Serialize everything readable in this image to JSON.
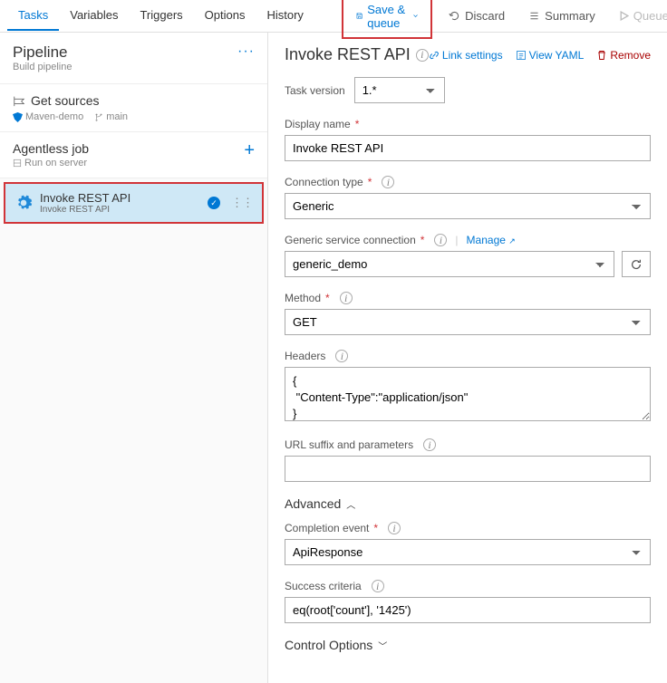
{
  "tabs": [
    "Tasks",
    "Variables",
    "Triggers",
    "Options",
    "History"
  ],
  "active_tab": 0,
  "toolbar": {
    "save": "Save & queue",
    "discard": "Discard",
    "summary": "Summary",
    "queue": "Queue",
    "more": "···"
  },
  "left": {
    "pipeline": {
      "title": "Pipeline",
      "sub": "Build pipeline"
    },
    "sources": {
      "title": "Get sources",
      "repo": "Maven-demo",
      "branch": "main"
    },
    "job": {
      "title": "Agentless job",
      "sub": "Run on server"
    },
    "task": {
      "title": "Invoke REST API",
      "sub": "Invoke REST API"
    }
  },
  "right": {
    "title": "Invoke REST API",
    "links": {
      "link": "Link settings",
      "yaml": "View YAML",
      "remove": "Remove"
    },
    "task_version": {
      "label": "Task version",
      "value": "1.*"
    },
    "display_name": {
      "label": "Display name",
      "value": "Invoke REST API"
    },
    "conn_type": {
      "label": "Connection type",
      "value": "Generic"
    },
    "service_conn": {
      "label": "Generic service connection",
      "value": "generic_demo",
      "manage": "Manage"
    },
    "method": {
      "label": "Method",
      "value": "GET"
    },
    "headers": {
      "label": "Headers",
      "value": "{\n \"Content-Type\":\"application/json\"\n}"
    },
    "url_suffix": {
      "label": "URL suffix and parameters",
      "value": ""
    },
    "advanced": "Advanced",
    "completion": {
      "label": "Completion event",
      "value": "ApiResponse"
    },
    "criteria": {
      "label": "Success criteria",
      "value": "eq(root['count'], '1425')"
    },
    "control": "Control Options"
  }
}
